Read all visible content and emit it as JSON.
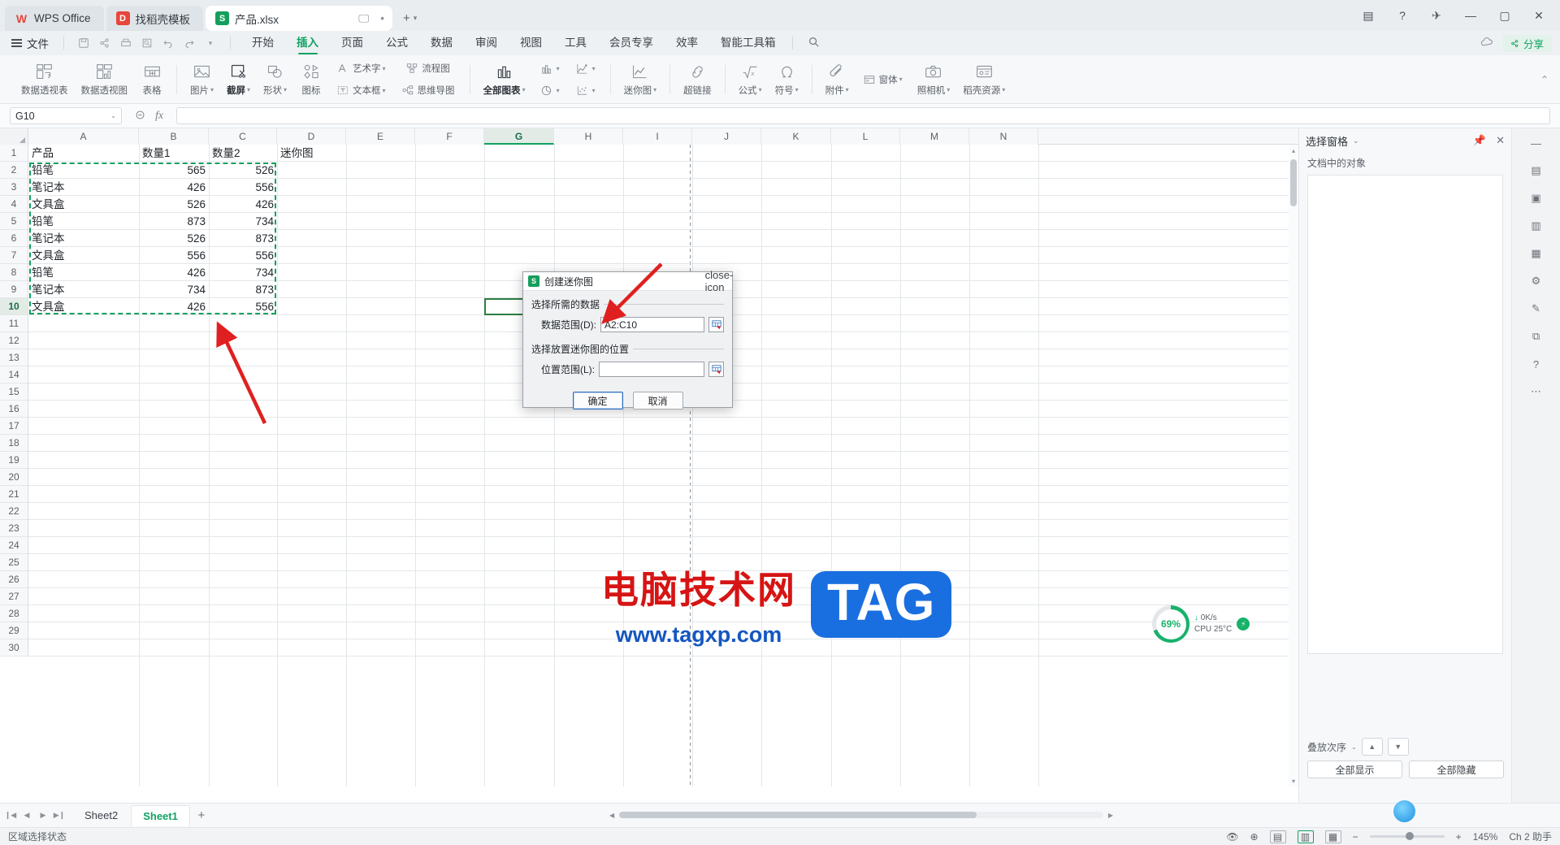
{
  "titlebar": {
    "tabs": [
      {
        "label": "WPS Office",
        "icon": "wps-logo-icon"
      },
      {
        "label": "找稻壳模板",
        "icon": "template-icon"
      },
      {
        "label": "产品.xlsx",
        "icon": "excel-file-icon"
      }
    ],
    "new_tab": "+",
    "window_controls": {
      "minimize": "—",
      "maximize": "▢",
      "close": "✕"
    }
  },
  "menubar": {
    "file_label": "文件",
    "quick_access": [
      "save-icon",
      "share-icon",
      "print-icon",
      "print-preview-icon",
      "undo-icon",
      "redo-icon",
      "customize-caret-icon"
    ],
    "tabs": [
      {
        "label": "开始",
        "active": false
      },
      {
        "label": "插入",
        "active": true
      },
      {
        "label": "页面",
        "active": false
      },
      {
        "label": "公式",
        "active": false
      },
      {
        "label": "数据",
        "active": false
      },
      {
        "label": "审阅",
        "active": false
      },
      {
        "label": "视图",
        "active": false
      },
      {
        "label": "工具",
        "active": false
      },
      {
        "label": "会员专享",
        "active": false
      },
      {
        "label": "效率",
        "active": false
      },
      {
        "label": "智能工具箱",
        "active": false
      }
    ],
    "search_icon": "search-icon",
    "share_label": "分享",
    "cloud_icon": "cloud-icon"
  },
  "ribbon": {
    "items": [
      {
        "label": "数据透视表",
        "icon": "pivot-table-icon",
        "caret": false,
        "dark": false
      },
      {
        "label": "数据透视图",
        "icon": "pivot-chart-icon",
        "caret": false,
        "dark": false
      },
      {
        "label": "表格",
        "icon": "table-icon",
        "caret": false,
        "dark": false
      },
      {
        "label": "图片",
        "icon": "picture-icon",
        "caret": true,
        "dark": false
      },
      {
        "label": "截屏",
        "icon": "screenshot-icon",
        "caret": true,
        "dark": true
      },
      {
        "label": "形状",
        "icon": "shapes-icon",
        "caret": true,
        "dark": false
      },
      {
        "label": "图标",
        "icon": "icons-icon",
        "caret": false,
        "dark": false
      }
    ],
    "stack_a": [
      {
        "label": "艺术字",
        "icon": "wordart-icon",
        "caret": true
      },
      {
        "label": "文本框",
        "icon": "textbox-icon",
        "caret": true
      }
    ],
    "stack_b": [
      {
        "label": "流程图",
        "icon": "flowchart-icon",
        "caret": false
      },
      {
        "label": "思维导图",
        "icon": "mindmap-icon",
        "caret": false
      }
    ],
    "charts": {
      "all_charts_label": "全部图表",
      "all_charts_icon": "column-chart-icon",
      "bar_icon": "bar-chart-icon",
      "pie_icon": "pie-chart-icon",
      "line_icon": "line-chart-icon",
      "scatter_icon": "scatter-chart-icon"
    },
    "sparkline": {
      "label": "迷你图",
      "icon": "sparkline-icon",
      "caret": true
    },
    "hyperlink": {
      "label": "超链接",
      "icon": "hyperlink-icon"
    },
    "formula": {
      "label": "公式",
      "icon": "sqrt-icon",
      "caret": true
    },
    "symbol": {
      "label": "符号",
      "icon": "omega-icon",
      "caret": true
    },
    "attachment": {
      "label": "附件",
      "icon": "attachment-icon",
      "caret": true
    },
    "camera": {
      "label": "照相机",
      "icon": "camera-icon",
      "caret": true
    },
    "form": {
      "label": "窗体",
      "icon": "form-icon",
      "caret": true
    },
    "resource": {
      "label": "稻壳资源",
      "icon": "resource-icon",
      "caret": true
    }
  },
  "formulabar": {
    "namebox_value": "G10",
    "namebox_caret": "⌄",
    "cancel_icon": "cancel-icon",
    "fx_icon": "fx-icon",
    "formula_value": ""
  },
  "sheet": {
    "columns": [
      "A",
      "B",
      "C",
      "D",
      "E",
      "F",
      "G",
      "H",
      "I",
      "J",
      "K",
      "L",
      "M",
      "N"
    ],
    "selected_column": "G",
    "selected_row": 10,
    "rows": [
      1,
      2,
      3,
      4,
      5,
      6,
      7,
      8,
      9,
      10,
      11,
      12,
      13,
      14,
      15,
      16,
      17,
      18,
      19,
      20,
      21,
      22,
      23,
      24,
      25,
      26,
      27,
      28,
      29,
      30
    ],
    "data": [
      {
        "row": 1,
        "A": "产品",
        "B": "数量1",
        "C": "数量2",
        "D": "迷你图"
      },
      {
        "row": 2,
        "A": "铅笔",
        "B": "565",
        "C": "526",
        "D": ""
      },
      {
        "row": 3,
        "A": "笔记本",
        "B": "426",
        "C": "556",
        "D": ""
      },
      {
        "row": 4,
        "A": "文具盒",
        "B": "526",
        "C": "426",
        "D": ""
      },
      {
        "row": 5,
        "A": "铅笔",
        "B": "873",
        "C": "734",
        "D": ""
      },
      {
        "row": 6,
        "A": "笔记本",
        "B": "526",
        "C": "873",
        "D": ""
      },
      {
        "row": 7,
        "A": "文具盒",
        "B": "556",
        "C": "556",
        "D": ""
      },
      {
        "row": 8,
        "A": "铅笔",
        "B": "426",
        "C": "734",
        "D": ""
      },
      {
        "row": 9,
        "A": "笔记本",
        "B": "734",
        "C": "873",
        "D": ""
      },
      {
        "row": 10,
        "A": "文具盒",
        "B": "426",
        "C": "556",
        "D": ""
      }
    ],
    "marching_ants_range": "A2:C10",
    "active_cell": "G10"
  },
  "dialog": {
    "title": "创建迷你图",
    "icon": "excel-app-icon",
    "close_icon": "close-icon",
    "group1_label": "选择所需的数据",
    "data_range_label": "数据范围(D):",
    "data_range_value": "A2:C10",
    "group2_label": "选择放置迷你图的位置",
    "location_label": "位置范围(L):",
    "location_value": "",
    "picker_icon": "range-picker-icon",
    "ok_label": "确定",
    "cancel_label": "取消"
  },
  "taskpane": {
    "title": "选择窗格",
    "title_caret": "⌄",
    "pin_icon": "pin-icon",
    "close_icon": "close-icon",
    "subtitle": "文档中的对象",
    "order_label": "叠放次序",
    "order_caret": "⌄",
    "up_icon": "arrow-up-icon",
    "down_icon": "arrow-down-icon",
    "show_all_label": "全部显示",
    "hide_all_label": "全部隐藏"
  },
  "rail": {
    "icons": [
      "minimize-panel-icon",
      "format-icon",
      "cell-icon",
      "chart-panel-icon",
      "picture-panel-icon",
      "settings-icon",
      "brush-icon",
      "layers-icon",
      "help-icon",
      "more-icon"
    ]
  },
  "sheettabs": {
    "nav": [
      "first-sheet-icon",
      "prev-sheet-icon",
      "next-sheet-icon",
      "last-sheet-icon"
    ],
    "tabs": [
      {
        "label": "Sheet2",
        "active": false
      },
      {
        "label": "Sheet1",
        "active": true
      }
    ],
    "add_label": "+"
  },
  "statusbar": {
    "left_text": "区域选择状态",
    "right_text": "Ch 2 助手",
    "eye_icon": "eye-icon",
    "settings_icon": "settings-gear-icon",
    "view_normal_icon": "view-normal-icon",
    "view_layout_icon": "view-pagelayout-icon",
    "view_break_icon": "view-pagebreak-icon",
    "zoom_minus": "−",
    "zoom_plus": "+",
    "zoom_value": "145%"
  },
  "watermark": {
    "cn_text": "电脑技术网",
    "url_text": "www.tagxp.com",
    "tag_text": "TAG"
  },
  "cpu_widget": {
    "percent": "69%",
    "speed": "0K/s",
    "temp": "CPU 25°C"
  },
  "colors": {
    "accent_green": "#10a262",
    "selection_green": "#2d7d41",
    "marching_green": "#13a05f",
    "arrow_red": "#e02020",
    "dialog_blue": "#2f6fbf",
    "watermark_red": "#d61414",
    "watermark_blue": "#1556c0"
  }
}
